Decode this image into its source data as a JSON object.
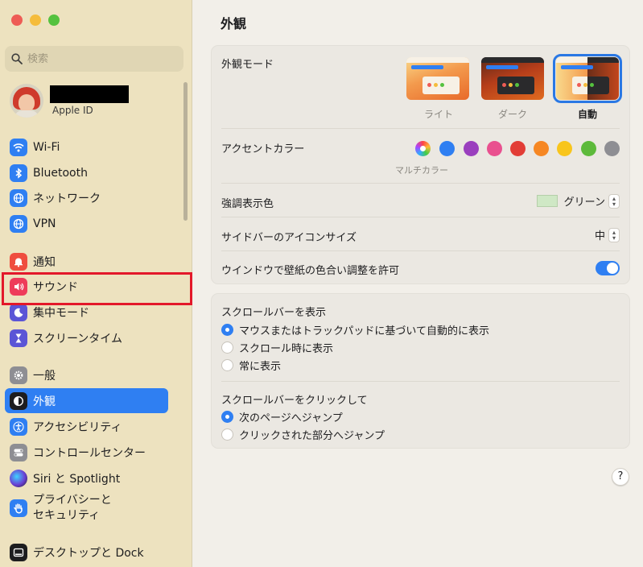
{
  "window": {
    "title": "外観"
  },
  "sidebar": {
    "search_placeholder": "検索",
    "profile": {
      "subtitle": "Apple ID"
    },
    "items": [
      {
        "label": "Wi-Fi",
        "icon": "wifi-icon",
        "color": "#2f7ff2"
      },
      {
        "label": "Bluetooth",
        "icon": "bluetooth-icon",
        "color": "#2f7ff2"
      },
      {
        "label": "ネットワーク",
        "icon": "globe-icon",
        "color": "#2f7ff2"
      },
      {
        "label": "VPN",
        "icon": "vpn-icon",
        "color": "#2f7ff2"
      },
      {
        "label": "通知",
        "icon": "bell-icon",
        "color": "#ef4d3f"
      },
      {
        "label": "サウンド",
        "icon": "speaker-icon",
        "color": "#ee3b5a"
      },
      {
        "label": "集中モード",
        "icon": "moon-icon",
        "color": "#5b55d6"
      },
      {
        "label": "スクリーンタイム",
        "icon": "hourglass-icon",
        "color": "#5b55d6"
      },
      {
        "label": "一般",
        "icon": "gear-icon",
        "color": "#8e8e93"
      },
      {
        "label": "外観",
        "icon": "appearance-icon",
        "color": "#1d1d1f",
        "selected": true
      },
      {
        "label": "アクセシビリティ",
        "icon": "accessibility-icon",
        "color": "#2f7ff2"
      },
      {
        "label": "コントロールセンター",
        "icon": "toggles-icon",
        "color": "#8e8e93"
      },
      {
        "label": "Siri と Spotlight",
        "icon": "siri-icon",
        "color": "#6a3fd4"
      },
      {
        "label": "プライバシーと\nセキュリティ",
        "icon": "hand-icon",
        "color": "#2f7ff2"
      },
      {
        "label": "デスクトップと Dock",
        "icon": "dock-icon",
        "color": "#1d1d1f"
      }
    ]
  },
  "main": {
    "appearance": {
      "label": "外観モード",
      "options": [
        {
          "caption": "ライト",
          "selected": false
        },
        {
          "caption": "ダーク",
          "selected": false
        },
        {
          "caption": "自動",
          "selected": true
        }
      ]
    },
    "accent": {
      "label": "アクセントカラー",
      "selected_caption": "マルチカラー",
      "colors": [
        "multicolor",
        "#2f7ff2",
        "#9a3fbe",
        "#e9508f",
        "#e23d36",
        "#f68723",
        "#f8c51c",
        "#5dba3b",
        "#8e8e93"
      ]
    },
    "highlight": {
      "label": "強調表示色",
      "value": "グリーン"
    },
    "sidebar_icon": {
      "label": "サイドバーのアイコンサイズ",
      "value": "中"
    },
    "wallpaper_tint": {
      "label": "ウインドウで壁紙の色合い調整を許可",
      "enabled": true
    },
    "scrollbars": {
      "label": "スクロールバーを表示",
      "options": [
        {
          "label": "マウスまたはトラックパッドに基づいて自動的に表示",
          "selected": true
        },
        {
          "label": "スクロール時に表示",
          "selected": false
        },
        {
          "label": "常に表示",
          "selected": false
        }
      ]
    },
    "scroll_click": {
      "label": "スクロールバーをクリックして",
      "options": [
        {
          "label": "次のページへジャンプ",
          "selected": true
        },
        {
          "label": "クリックされた部分へジャンプ",
          "selected": false
        }
      ]
    },
    "help_label": "?"
  }
}
